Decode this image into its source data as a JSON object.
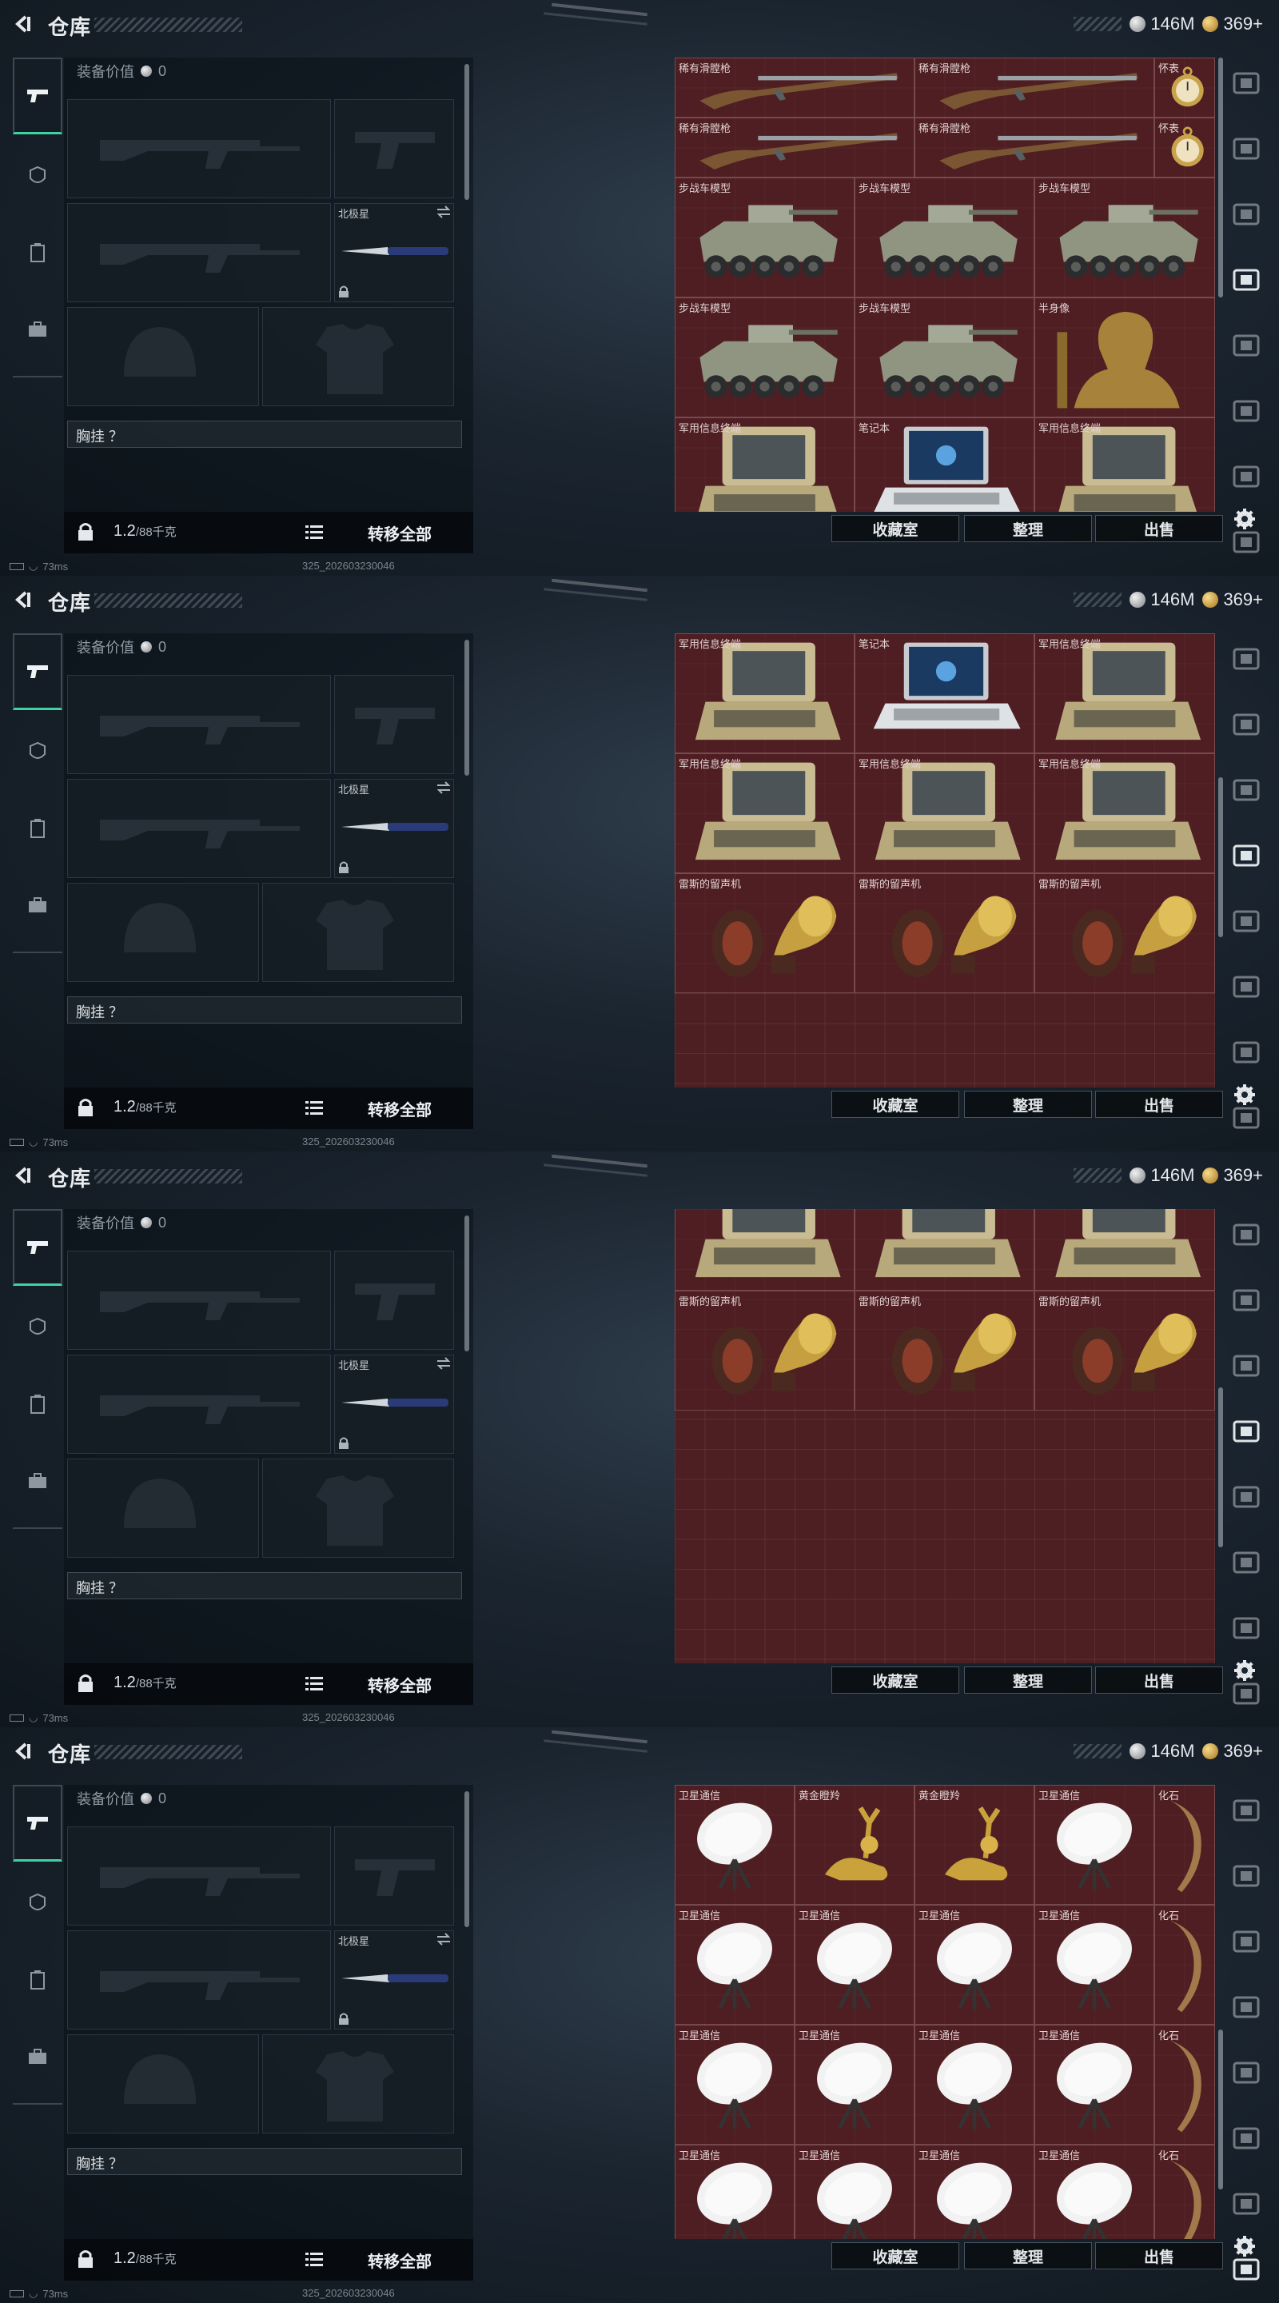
{
  "header": {
    "title": "仓库",
    "currency_silver": "146M",
    "currency_gold": "369+"
  },
  "equipment": {
    "value_label": "装备价值",
    "value": "0",
    "melee_label": "北极星",
    "chest_rig_label": "胸挂 ？",
    "weight": "1.2",
    "weight_capacity": "/88千克",
    "transfer_all_label": "转移全部"
  },
  "actions": {
    "collection": "收藏室",
    "sort": "整理",
    "sell": "出售"
  },
  "footer": {
    "ping": "73ms",
    "build": "325_202603230046"
  },
  "items": {
    "rare_musket": "稀有滑膛枪",
    "pocket_watch": "怀表",
    "ifv_model": "步战车模型",
    "bust": "半身像",
    "mil_terminal": "军用信息终端",
    "laptop": "笔记本",
    "gramophone": "雷斯的留声机",
    "satcom": "卫星通信",
    "golden_deer": "黄金瞪羚",
    "fossil": "化石"
  },
  "screens": [
    {
      "name": "screen-1",
      "scroll_fraction": 0.0
    },
    {
      "name": "screen-2",
      "scroll_fraction": 0.5
    },
    {
      "name": "screen-3",
      "scroll_fraction": 0.62
    },
    {
      "name": "screen-4",
      "scroll_fraction": 0.85
    }
  ]
}
